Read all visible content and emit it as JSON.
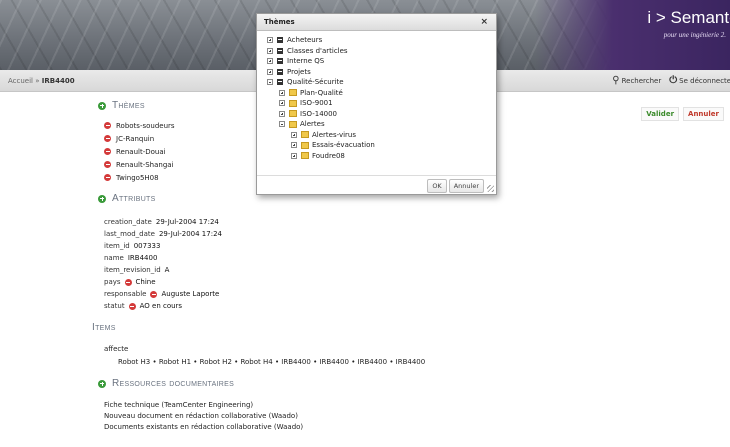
{
  "brand": {
    "title": "i > Semanteo",
    "subtitle": "pour une ingénierie 2."
  },
  "breadcrumb": {
    "home": "Accueil",
    "sep": "»",
    "current": "IRB4400"
  },
  "toplinks": {
    "search": "Rechercher",
    "logout": "Se déconnecter"
  },
  "actions": {
    "validate": "Valider",
    "cancel": "Annuler"
  },
  "sections": {
    "themes": "Thèmes",
    "attributes": "Attributs",
    "items": "Items",
    "resources": "Ressources documentaires"
  },
  "themes": [
    "Robots-soudeurs",
    "JC-Ranquin",
    "Renault-Douai",
    "Renault-Shangai",
    "Twingo5H08"
  ],
  "attributes": [
    {
      "key": "creation_date",
      "value": "29-Jul-2004 17:24"
    },
    {
      "key": "last_mod_date",
      "value": "29-Jul-2004 17:24"
    },
    {
      "key": "item_id",
      "value": "007333"
    },
    {
      "key": "name",
      "value": "IRB4400"
    },
    {
      "key": "item_revision_id",
      "value": "A"
    },
    {
      "key": "pays",
      "value": "Chine"
    },
    {
      "key": "responsable",
      "value": "Auguste Laporte"
    },
    {
      "key": "statut",
      "value": "AO en cours"
    }
  ],
  "items": {
    "label": "affecte",
    "row": "Robot H3  •  Robot H1  •  Robot H2  •  Robot H4  •  IRB4400  •  IRB4400  •  IRB4400  •  IRB4400"
  },
  "resources": [
    "Fiche technique (TeamCenter Engineering)",
    "Nouveau document en rédaction collaborative (Waado)",
    "Documents existants en rédaction collaborative (Waado)"
  ],
  "dialog": {
    "title": "Thèmes",
    "close": "×",
    "tree": {
      "acheteurs": "Acheteurs",
      "classes": "Classes d'articles",
      "interne": "Interne QS",
      "projets": "Projets",
      "qualite": "Qualité-Sécurite",
      "plan": "Plan-Qualité",
      "iso9001": "ISO-9001",
      "iso14000": "ISO-14000",
      "alertes": "Alertes",
      "virus": "Alertes-virus",
      "evac": "Essais-évacuation",
      "foudre": "Foudre08"
    },
    "ok": "OK",
    "cancel": "Annuler"
  }
}
